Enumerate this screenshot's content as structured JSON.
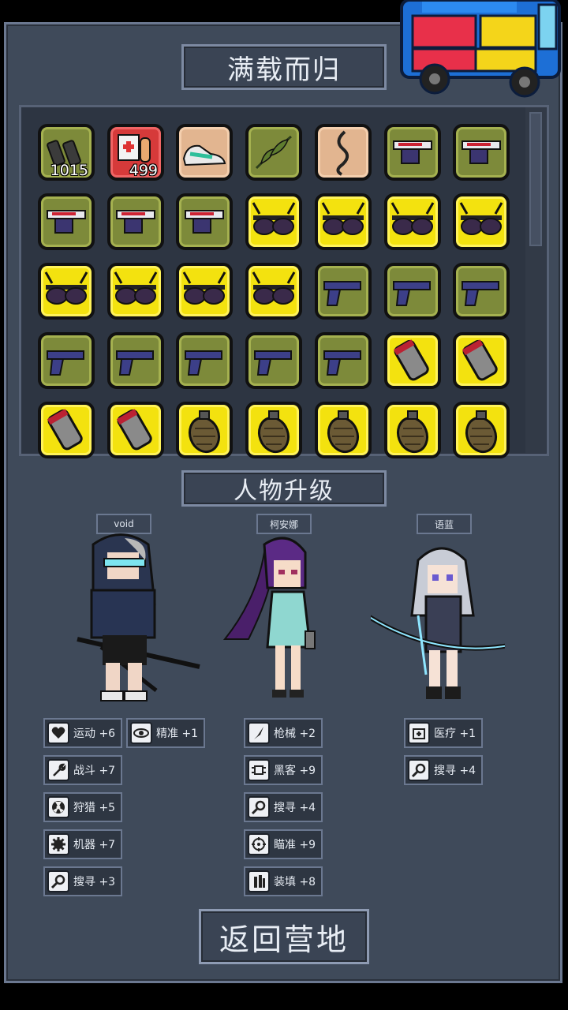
{
  "header": {
    "title": "满载而归"
  },
  "inventory": {
    "rows": [
      [
        {
          "item": "magazine",
          "bg": "olive",
          "count": "1015"
        },
        {
          "item": "medkit",
          "bg": "red",
          "count": "499"
        },
        {
          "item": "sneaker",
          "bg": "tan",
          "count": ""
        },
        {
          "item": "herb",
          "bg": "olive",
          "count": ""
        },
        {
          "item": "cord",
          "bg": "tan",
          "count": ""
        },
        {
          "item": "smg",
          "bg": "olive",
          "count": ""
        },
        {
          "item": "smg",
          "bg": "olive",
          "count": ""
        }
      ],
      [
        {
          "item": "smg",
          "bg": "olive",
          "count": ""
        },
        {
          "item": "smg",
          "bg": "olive",
          "count": ""
        },
        {
          "item": "smg",
          "bg": "olive",
          "count": ""
        },
        {
          "item": "sunglasses",
          "bg": "yellow",
          "count": ""
        },
        {
          "item": "sunglasses",
          "bg": "yellow",
          "count": ""
        },
        {
          "item": "sunglasses",
          "bg": "yellow",
          "count": ""
        },
        {
          "item": "sunglasses",
          "bg": "yellow",
          "count": ""
        }
      ],
      [
        {
          "item": "sunglasses",
          "bg": "yellow",
          "count": ""
        },
        {
          "item": "sunglasses",
          "bg": "yellow",
          "count": ""
        },
        {
          "item": "sunglasses",
          "bg": "yellow",
          "count": ""
        },
        {
          "item": "sunglasses",
          "bg": "yellow",
          "count": ""
        },
        {
          "item": "pistol",
          "bg": "olive",
          "count": ""
        },
        {
          "item": "pistol",
          "bg": "olive",
          "count": ""
        },
        {
          "item": "pistol",
          "bg": "olive",
          "count": ""
        }
      ],
      [
        {
          "item": "pistol",
          "bg": "olive",
          "count": ""
        },
        {
          "item": "pistol",
          "bg": "olive",
          "count": ""
        },
        {
          "item": "pistol",
          "bg": "olive",
          "count": ""
        },
        {
          "item": "pistol",
          "bg": "olive",
          "count": ""
        },
        {
          "item": "pistol",
          "bg": "olive",
          "count": ""
        },
        {
          "item": "canister",
          "bg": "yellow",
          "count": ""
        },
        {
          "item": "canister",
          "bg": "yellow",
          "count": ""
        }
      ],
      [
        {
          "item": "canister",
          "bg": "yellow",
          "count": ""
        },
        {
          "item": "canister",
          "bg": "yellow",
          "count": ""
        },
        {
          "item": "grenade",
          "bg": "yellow",
          "count": ""
        },
        {
          "item": "grenade",
          "bg": "yellow",
          "count": ""
        },
        {
          "item": "grenade",
          "bg": "yellow",
          "count": ""
        },
        {
          "item": "grenade",
          "bg": "yellow",
          "count": ""
        },
        {
          "item": "grenade",
          "bg": "yellow",
          "count": ""
        }
      ]
    ]
  },
  "upgrade": {
    "title": "人物升级"
  },
  "characters": [
    {
      "name": "void",
      "stats": [
        {
          "icon": "heart-icon",
          "label": "运动 +6"
        },
        {
          "icon": "eye-icon",
          "label": "精准 +1"
        },
        {
          "icon": "wrench-icon",
          "label": "战斗 +7"
        },
        {
          "icon": "radiation-icon",
          "label": "狩猎 +5"
        },
        {
          "icon": "gear-icon",
          "label": "机器 +7"
        },
        {
          "icon": "magnifier-icon",
          "label": "搜寻 +3"
        }
      ]
    },
    {
      "name": "柯安娜",
      "stats": [
        {
          "icon": "knife-icon",
          "label": "枪械 +2"
        },
        {
          "icon": "circuit-icon",
          "label": "黑客 +9"
        },
        {
          "icon": "magnifier-icon",
          "label": "搜寻 +4"
        },
        {
          "icon": "crosshair-icon",
          "label": "瞄准 +9"
        },
        {
          "icon": "ammo-icon",
          "label": "装填 +8"
        }
      ]
    },
    {
      "name": "语蓝",
      "stats": [
        {
          "icon": "medical-icon",
          "label": "医疗 +1"
        },
        {
          "icon": "magnifier-icon",
          "label": "搜寻 +4"
        }
      ]
    }
  ],
  "footer": {
    "return_label": "返回营地"
  },
  "colors": {
    "olive": "#7d8a3a",
    "yellow": "#f3e20f",
    "red": "#d63a3a",
    "tan": "#e2b590",
    "panel": "#3f4a5a"
  }
}
